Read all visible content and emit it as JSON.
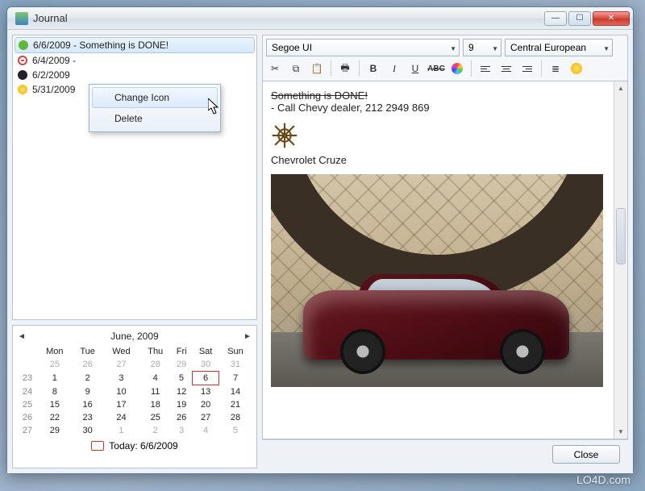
{
  "window": {
    "title": "Journal"
  },
  "entries": [
    {
      "icon": "green-dot",
      "text": "6/6/2009 - Something is DONE!",
      "selected": true
    },
    {
      "icon": "red-ring",
      "text": "6/4/2009 -"
    },
    {
      "icon": "black-dot",
      "text": "6/2/2009"
    },
    {
      "icon": "smile",
      "text": "5/31/2009"
    }
  ],
  "context_menu": {
    "items": [
      {
        "label": "Change Icon",
        "hovered": true
      },
      {
        "label": "Delete"
      }
    ]
  },
  "toolbar": {
    "font": "Segoe UI",
    "size": "9",
    "charset": "Central European",
    "buttons": {
      "bold": "B",
      "italic": "I",
      "underline": "U",
      "strike": "ABC"
    }
  },
  "editor": {
    "line1_struck": "Something is DONE!",
    "line2": "- Call Chevy dealer, 212 2949 869",
    "caption": "Chevrolet Cruze"
  },
  "calendar": {
    "month_label": "June, 2009",
    "today_label": "Today: 6/6/2009",
    "day_headers": [
      "Mon",
      "Tue",
      "Wed",
      "Thu",
      "Fri",
      "Sat",
      "Sun"
    ],
    "weeks": [
      {
        "wk": "",
        "days": [
          {
            "n": "25",
            "o": true
          },
          {
            "n": "26",
            "o": true
          },
          {
            "n": "27",
            "o": true
          },
          {
            "n": "28",
            "o": true
          },
          {
            "n": "29",
            "o": true
          },
          {
            "n": "30",
            "o": true
          },
          {
            "n": "31",
            "o": true
          }
        ]
      },
      {
        "wk": "23",
        "days": [
          {
            "n": "1"
          },
          {
            "n": "2"
          },
          {
            "n": "3"
          },
          {
            "n": "4"
          },
          {
            "n": "5"
          },
          {
            "n": "6",
            "today": true
          },
          {
            "n": "7"
          }
        ]
      },
      {
        "wk": "24",
        "days": [
          {
            "n": "8"
          },
          {
            "n": "9"
          },
          {
            "n": "10"
          },
          {
            "n": "11"
          },
          {
            "n": "12"
          },
          {
            "n": "13"
          },
          {
            "n": "14"
          }
        ]
      },
      {
        "wk": "25",
        "days": [
          {
            "n": "15"
          },
          {
            "n": "16"
          },
          {
            "n": "17"
          },
          {
            "n": "18"
          },
          {
            "n": "19"
          },
          {
            "n": "20"
          },
          {
            "n": "21"
          }
        ]
      },
      {
        "wk": "26",
        "days": [
          {
            "n": "22"
          },
          {
            "n": "23"
          },
          {
            "n": "24"
          },
          {
            "n": "25"
          },
          {
            "n": "26"
          },
          {
            "n": "27"
          },
          {
            "n": "28"
          }
        ]
      },
      {
        "wk": "27",
        "days": [
          {
            "n": "29"
          },
          {
            "n": "30"
          },
          {
            "n": "1",
            "o": true
          },
          {
            "n": "2",
            "o": true
          },
          {
            "n": "3",
            "o": true
          },
          {
            "n": "4",
            "o": true
          },
          {
            "n": "5",
            "o": true
          }
        ]
      }
    ]
  },
  "footer": {
    "close": "Close"
  },
  "watermark": "LO4D.com"
}
